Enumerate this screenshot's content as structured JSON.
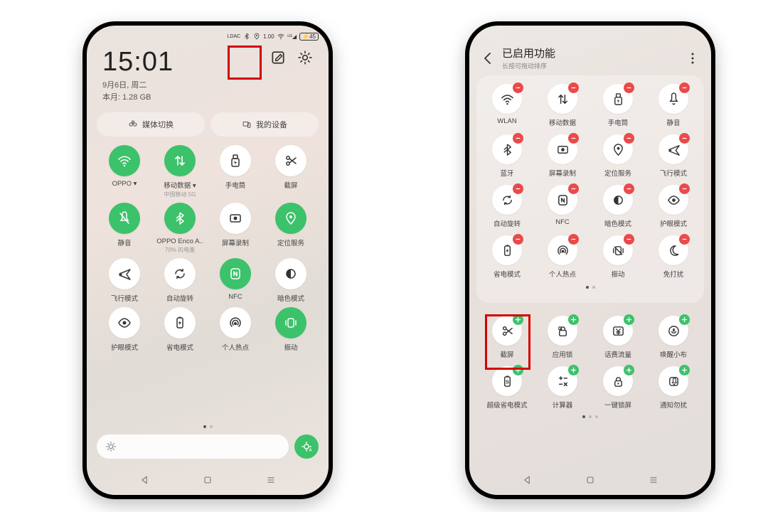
{
  "status": {
    "battery": "45"
  },
  "left": {
    "time": "15:01",
    "date": "9月6日, 周二",
    "usage": "本月: 1.28 GB",
    "pill_media": "媒体切换",
    "pill_devices": "我的设备",
    "tiles": [
      {
        "label": "OPPO ▾",
        "icon": "wifi",
        "on": true
      },
      {
        "label": "移动数据 ▾",
        "sub": "中国移动 5G",
        "icon": "updown",
        "on": true
      },
      {
        "label": "手电筒",
        "icon": "flash",
        "on": false
      },
      {
        "label": "截屏",
        "icon": "scissors",
        "on": false
      },
      {
        "label": "静音",
        "icon": "mute",
        "on": true
      },
      {
        "label": "OPPO Enco A..",
        "sub": "70% 的电量",
        "icon": "bt",
        "on": true
      },
      {
        "label": "屏幕录制",
        "icon": "rec",
        "on": false
      },
      {
        "label": "定位服务",
        "icon": "loc",
        "on": true
      },
      {
        "label": "飞行模式",
        "icon": "plane",
        "on": false
      },
      {
        "label": "自动旋转",
        "icon": "rotate",
        "on": false
      },
      {
        "label": "NFC",
        "icon": "nfc",
        "on": true
      },
      {
        "label": "暗色模式",
        "icon": "dark",
        "on": false
      },
      {
        "label": "护眼模式",
        "icon": "eye",
        "on": false
      },
      {
        "label": "省电模式",
        "icon": "battery",
        "on": false
      },
      {
        "label": "个人热点",
        "icon": "hotspot",
        "on": false
      },
      {
        "label": "振动",
        "icon": "vibrate",
        "on": true
      }
    ]
  },
  "right": {
    "title": "已启用功能",
    "subtitle": "长按可拖动排序",
    "enabled": [
      {
        "label": "WLAN",
        "icon": "wifi"
      },
      {
        "label": "移动数据",
        "icon": "updown"
      },
      {
        "label": "手电筒",
        "icon": "flash"
      },
      {
        "label": "静音",
        "icon": "bell"
      },
      {
        "label": "蓝牙",
        "icon": "bt"
      },
      {
        "label": "屏幕录制",
        "icon": "rec"
      },
      {
        "label": "定位服务",
        "icon": "loc"
      },
      {
        "label": "飞行模式",
        "icon": "plane"
      },
      {
        "label": "自动旋转",
        "icon": "rotate"
      },
      {
        "label": "NFC",
        "icon": "nfc"
      },
      {
        "label": "暗色模式",
        "icon": "dark"
      },
      {
        "label": "护眼模式",
        "icon": "eye"
      },
      {
        "label": "省电模式",
        "icon": "battery"
      },
      {
        "label": "个人热点",
        "icon": "hotspot"
      },
      {
        "label": "振动",
        "icon": "vibrateoff"
      },
      {
        "label": "免打扰",
        "icon": "moon"
      }
    ],
    "disabled": [
      {
        "label": "截屏",
        "icon": "scissors"
      },
      {
        "label": "应用锁",
        "icon": "applock"
      },
      {
        "label": "话费流量",
        "icon": "yuan"
      },
      {
        "label": "唤醒小布",
        "icon": "voice"
      },
      {
        "label": "超级省电模式",
        "icon": "superbat"
      },
      {
        "label": "计算器",
        "icon": "calc"
      },
      {
        "label": "一键锁屏",
        "icon": "lock"
      },
      {
        "label": "通知勿扰",
        "icon": "dnd"
      }
    ]
  }
}
